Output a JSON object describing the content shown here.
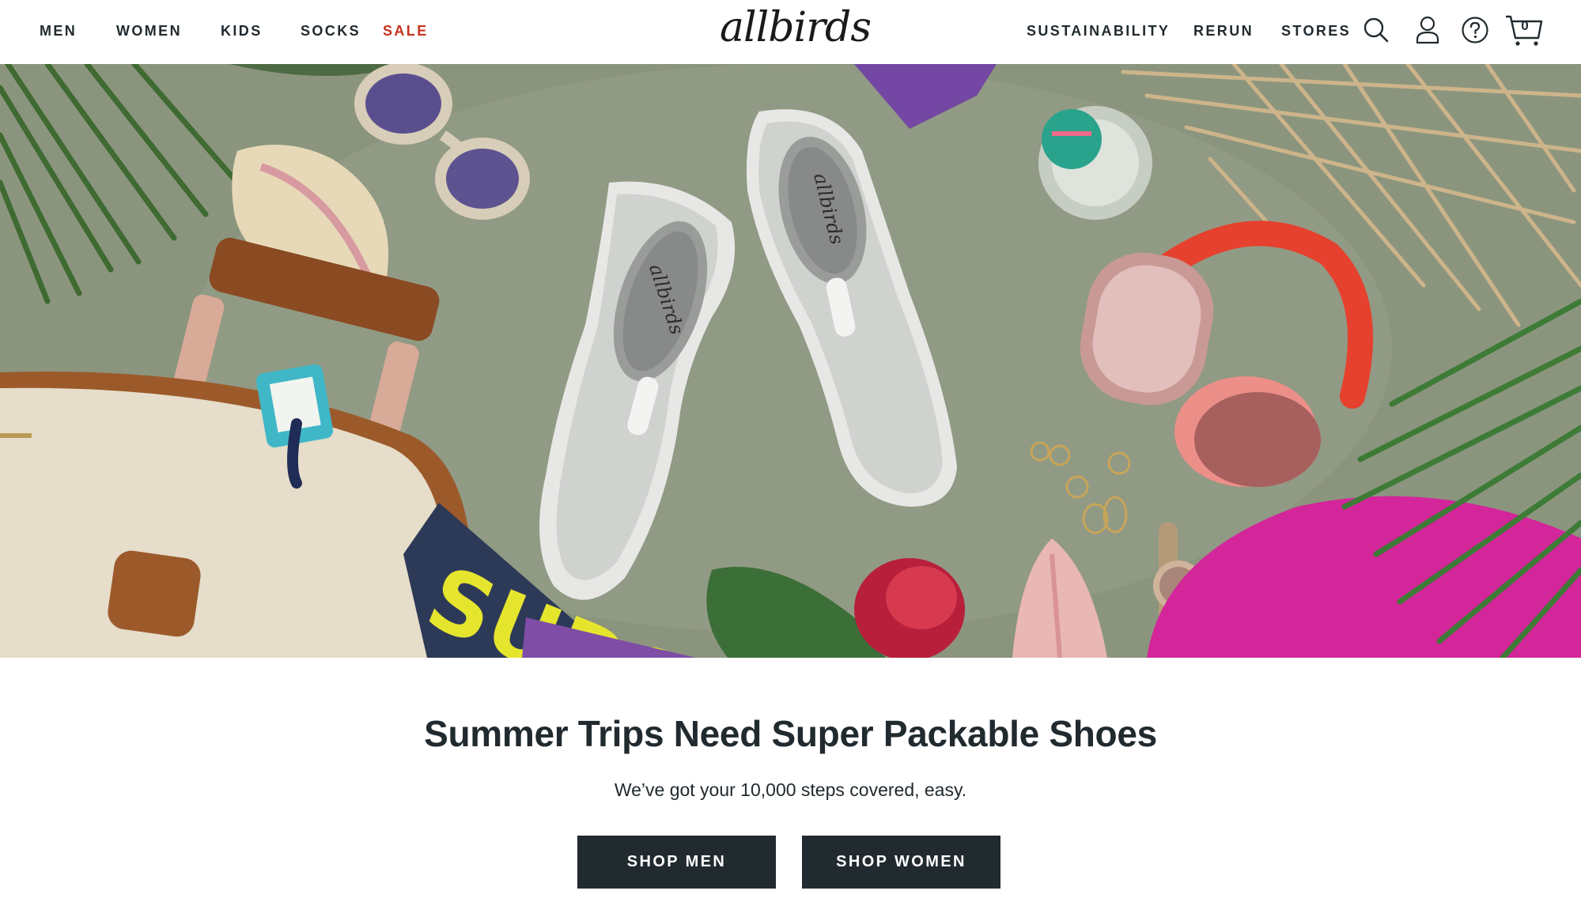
{
  "nav": {
    "left": [
      "MEN",
      "WOMEN",
      "KIDS",
      "SOCKS",
      "SALE"
    ],
    "right": [
      "SUSTAINABILITY",
      "RERUN",
      "STORES"
    ]
  },
  "brand": {
    "logo_text": "allbirds"
  },
  "icons": {
    "search": "search-icon",
    "account": "account-icon",
    "help": "help-icon",
    "cart": "cart-icon"
  },
  "cart": {
    "count": "0"
  },
  "hero": {
    "shoe_brand_mark": "allbirds",
    "magazine_text": "SUDS"
  },
  "promo": {
    "title": "Summer Trips Need Super Packable Shoes",
    "subtitle": "We’ve got your 10,000 steps covered, easy.",
    "buttons": [
      "SHOP MEN",
      "SHOP WOMEN"
    ]
  },
  "colors": {
    "text": "#212a2f",
    "sale": "#c8321e",
    "button_bg": "#212a2f",
    "hero_bg": "#8e9880"
  }
}
